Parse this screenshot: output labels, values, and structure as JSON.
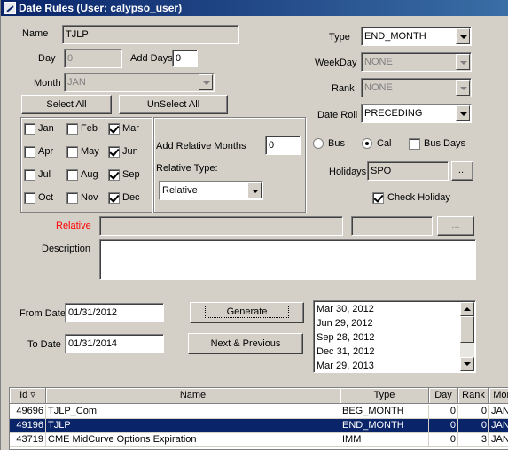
{
  "window": {
    "title": "Date Rules (User: calypso_user)"
  },
  "form": {
    "name_label": "Name",
    "name_value": "TJLP",
    "day_label": "Day",
    "day_value": "0",
    "add_days_label": "Add Days",
    "add_days_value": "0",
    "month_label": "Month",
    "month_value": "JAN",
    "type_label": "Type",
    "type_value": "END_MONTH",
    "weekday_label": "WeekDay",
    "weekday_value": "NONE",
    "rank_label": "Rank",
    "rank_value": "NONE",
    "date_roll_label": "Date Roll",
    "date_roll_value": "PRECEDING",
    "select_all": "Select All",
    "unselect_all": "UnSelect All",
    "months": [
      {
        "label": "Jan",
        "checked": false
      },
      {
        "label": "Feb",
        "checked": false
      },
      {
        "label": "Mar",
        "checked": true
      },
      {
        "label": "Apr",
        "checked": false
      },
      {
        "label": "May",
        "checked": false
      },
      {
        "label": "Jun",
        "checked": true
      },
      {
        "label": "Jul",
        "checked": false
      },
      {
        "label": "Aug",
        "checked": false
      },
      {
        "label": "Sep",
        "checked": true
      },
      {
        "label": "Oct",
        "checked": false
      },
      {
        "label": "Nov",
        "checked": false
      },
      {
        "label": "Dec",
        "checked": true
      }
    ],
    "add_relative_months_label": "Add Relative Months",
    "add_relative_months_value": "0",
    "relative_type_label": "Relative Type:",
    "relative_type_value": "Relative",
    "bus_label": "Bus",
    "cal_label": "Cal",
    "bus_days_label": "Bus Days",
    "holidays_label": "Holidays",
    "holidays_value": "SPO",
    "ellipsis": "...",
    "check_holiday_label": "Check Holiday",
    "relative_label": "Relative",
    "description_label": "Description",
    "from_date_label": "From Date",
    "from_date_value": "01/31/2012",
    "to_date_label": "To Date",
    "to_date_value": "01/31/2014",
    "generate": "Generate",
    "next_previous": "Next & Previous",
    "dates": [
      "Mar 30, 2012",
      "Jun 29, 2012",
      "Sep 28, 2012",
      "Dec 31, 2012",
      "Mar 29, 2013"
    ]
  },
  "colors": {
    "relative_label": "#ff0000",
    "selection": "#0a246a"
  },
  "table": {
    "headers": [
      "Id ▿",
      "Name",
      "Type",
      "Day",
      "Rank",
      "Month"
    ],
    "rows": [
      {
        "id": "49696",
        "name": "TJLP_Com",
        "type": "BEG_MONTH",
        "day": "0",
        "rank": "0",
        "month": "JAN",
        "selected": false
      },
      {
        "id": "49196",
        "name": "TJLP",
        "type": "END_MONTH",
        "day": "0",
        "rank": "0",
        "month": "JAN",
        "selected": true
      },
      {
        "id": "43719",
        "name": "CME MidCurve Options Expiration",
        "type": "IMM",
        "day": "0",
        "rank": "3",
        "month": "JAN",
        "selected": false
      }
    ]
  }
}
